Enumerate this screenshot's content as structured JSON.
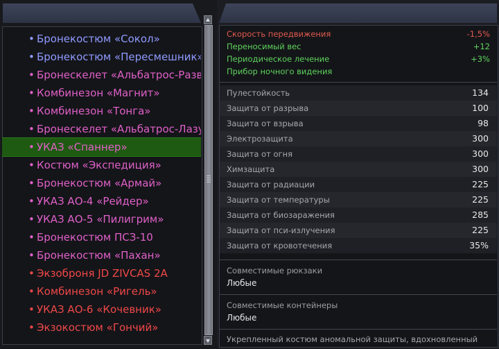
{
  "item_list": {
    "items": [
      {
        "name": "Бронекостюм «Сокол»",
        "color": "#8f9aff"
      },
      {
        "name": "Бронекостюм «Пересмешник»",
        "color": "#8f9aff"
      },
      {
        "name": "Бронескелет «Альбатрос-Развед",
        "color": "#e060c8"
      },
      {
        "name": "Комбинезон «Магнит»",
        "color": "#e060c8"
      },
      {
        "name": "Комбинезон «Тонга»",
        "color": "#e060c8"
      },
      {
        "name": "Бронескелет «Альбатрос-Лазутч",
        "color": "#e060c8"
      },
      {
        "name": "УКАЗ «Спаннер»",
        "color": "#e060c8",
        "selected": true
      },
      {
        "name": "Костюм «Экспедиция»",
        "color": "#e060c8"
      },
      {
        "name": "Бронекостюм «Армай»",
        "color": "#e060c8"
      },
      {
        "name": "УКАЗ АО-4 «Рейдер»",
        "color": "#e060c8"
      },
      {
        "name": "УКАЗ АО-5 «Пилигрим»",
        "color": "#e060c8"
      },
      {
        "name": "Бронекостюм ПСЗ-10",
        "color": "#e060c8"
      },
      {
        "name": "Бронекостюм «Пахан»",
        "color": "#e060c8"
      },
      {
        "name": "Экзоброня JD ZIVCAS 2A",
        "color": "#f04848"
      },
      {
        "name": "Комбинезон «Ригель»",
        "color": "#f04848"
      },
      {
        "name": "УКАЗ АО-6 «Кочевник»",
        "color": "#f04848"
      },
      {
        "name": "Экзокостюм «Гончий»",
        "color": "#f04848"
      }
    ],
    "bullet": "•",
    "selected_bg": "#1f5a12"
  },
  "effects": [
    {
      "name": "Скорость передвижения",
      "value": "-1,5%",
      "color": "#e05a4e"
    },
    {
      "name": "Переносимый вес",
      "value": "+12",
      "color": "#5ed45c"
    },
    {
      "name": "Периодическое лечение",
      "value": "+3%",
      "color": "#5ed45c"
    },
    {
      "name": "Прибор ночного видения",
      "value": "",
      "color": "#5ed45c"
    }
  ],
  "stats": [
    {
      "name": "Пулестойкость",
      "value": "134"
    },
    {
      "name": "Защита от разрыва",
      "value": "100"
    },
    {
      "name": "Защита от взрыва",
      "value": "98"
    },
    {
      "name": "Электрозащита",
      "value": "300"
    },
    {
      "name": "Защита от огня",
      "value": "300"
    },
    {
      "name": "Химзащита",
      "value": "300"
    },
    {
      "name": "Защита от радиации",
      "value": "225"
    },
    {
      "name": "Защита от температуры",
      "value": "225"
    },
    {
      "name": "Защита от биозаражения",
      "value": "285"
    },
    {
      "name": "Защита от пси-излучения",
      "value": "225"
    },
    {
      "name": "Защита от кровотечения",
      "value": "35%"
    }
  ],
  "compat": {
    "backpacks_label": "Совместимые рюкзаки",
    "backpacks_value": "Любые",
    "containers_label": "Совместимые контейнеры",
    "containers_value": "Любые"
  },
  "description": "Укрепленный костюм аномальной защиты, вдохновленный",
  "colors": {
    "header": "#353b4f",
    "panel_bg": "#141519"
  }
}
